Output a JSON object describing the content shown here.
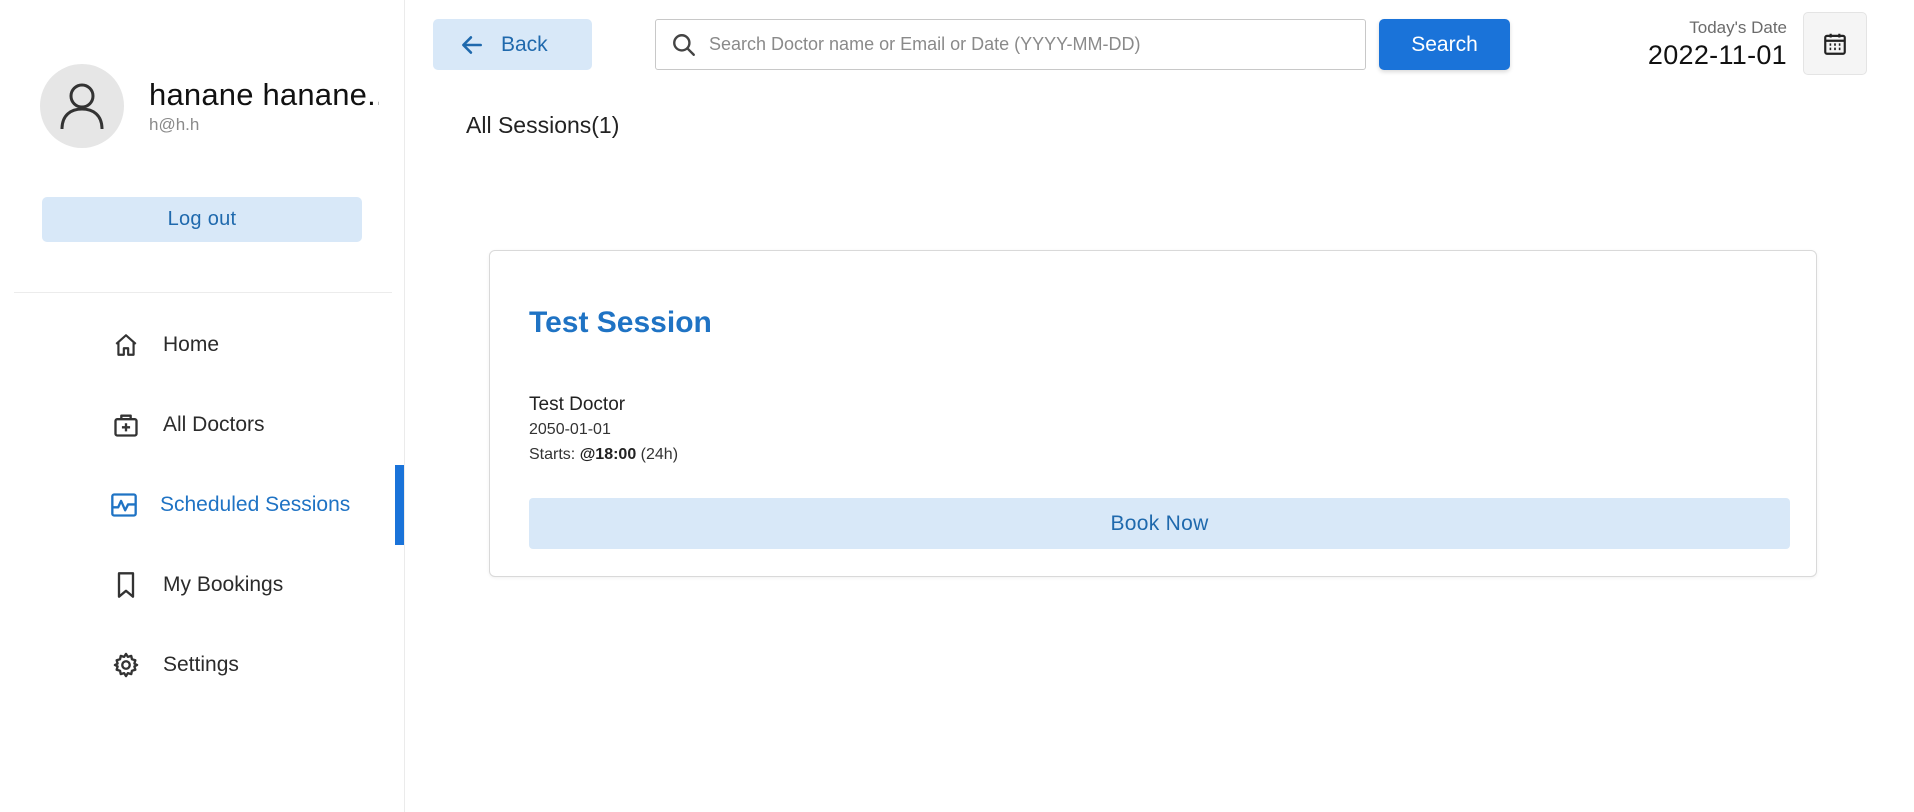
{
  "profile": {
    "name": "hanane hanane..",
    "email": "h@h.h",
    "logout_label": "Log out"
  },
  "sidebar": {
    "items": [
      {
        "label": "Home",
        "icon": "home-icon"
      },
      {
        "label": "All Doctors",
        "icon": "doctor-bag-icon"
      },
      {
        "label": "Scheduled Sessions",
        "icon": "session-chart-icon",
        "active": true
      },
      {
        "label": "My Bookings",
        "icon": "bookmark-icon"
      },
      {
        "label": "Settings",
        "icon": "gear-icon"
      }
    ]
  },
  "header": {
    "back_label": "Back",
    "search_placeholder": "Search Doctor name or Email or Date (YYYY-MM-DD)",
    "search_value": "",
    "search_label": "Search",
    "date_caption": "Today's Date",
    "date_value": "2022-11-01"
  },
  "main": {
    "section_title": "All Sessions(1)",
    "sessions": [
      {
        "title": "Test Session",
        "doctor": "Test Doctor",
        "date": "2050-01-01",
        "starts_prefix": "Starts:",
        "starts_time": "@18:00",
        "starts_suffix": "(24h)",
        "book_label": "Book Now"
      }
    ]
  },
  "colors": {
    "accent": "#1a73d9",
    "accent_light": "#d8e8f8",
    "accent_text": "#1f69ad"
  }
}
